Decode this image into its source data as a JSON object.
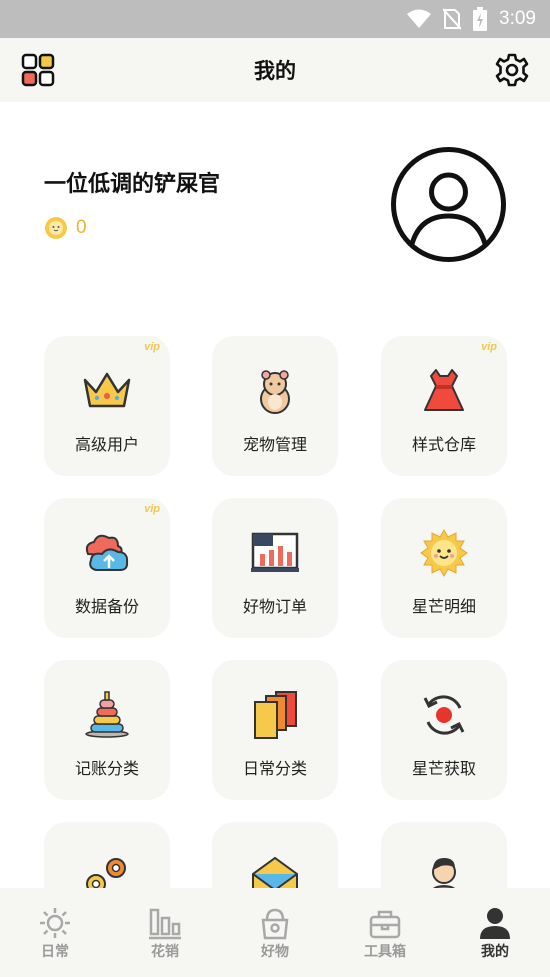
{
  "status": {
    "time": "3:09"
  },
  "header": {
    "title": "我的",
    "left_icon": "grid-apps-icon",
    "right_icon": "gear-icon"
  },
  "profile": {
    "name": "一位低调的铲屎官",
    "coin_count": "0",
    "coin_icon": "sun-coin-icon",
    "avatar_icon": "user-avatar-icon"
  },
  "grid": [
    {
      "label": "高级用户",
      "vip": "vip",
      "icon": "crown-icon"
    },
    {
      "label": "宠物管理",
      "vip": "",
      "icon": "hamster-icon"
    },
    {
      "label": "样式仓库",
      "vip": "vip",
      "icon": "dress-icon"
    },
    {
      "label": "数据备份",
      "vip": "vip",
      "icon": "cloud-upload-icon"
    },
    {
      "label": "好物订单",
      "vip": "",
      "icon": "chart-board-icon"
    },
    {
      "label": "星芒明细",
      "vip": "",
      "icon": "sun-icon"
    },
    {
      "label": "记账分类",
      "vip": "",
      "icon": "ring-stack-icon"
    },
    {
      "label": "日常分类",
      "vip": "",
      "icon": "folders-icon"
    },
    {
      "label": "星芒获取",
      "vip": "",
      "icon": "refresh-icon"
    },
    {
      "label": "",
      "vip": "",
      "icon": "gears-icon"
    },
    {
      "label": "",
      "vip": "",
      "icon": "mail-icon"
    },
    {
      "label": "",
      "vip": "",
      "icon": "person-icon"
    }
  ],
  "tabs": [
    {
      "label": "日常",
      "icon": "sun-tab-icon",
      "active": false
    },
    {
      "label": "花销",
      "icon": "bar-chart-tab-icon",
      "active": false
    },
    {
      "label": "好物",
      "icon": "pet-bowl-tab-icon",
      "active": false
    },
    {
      "label": "工具箱",
      "icon": "toolbox-tab-icon",
      "active": false
    },
    {
      "label": "我的",
      "icon": "user-tab-icon",
      "active": true
    }
  ],
  "colors": {
    "accent_yellow": "#f2c74a",
    "card_bg": "#f6f6f3",
    "statusbar": "#bdbdbd"
  }
}
